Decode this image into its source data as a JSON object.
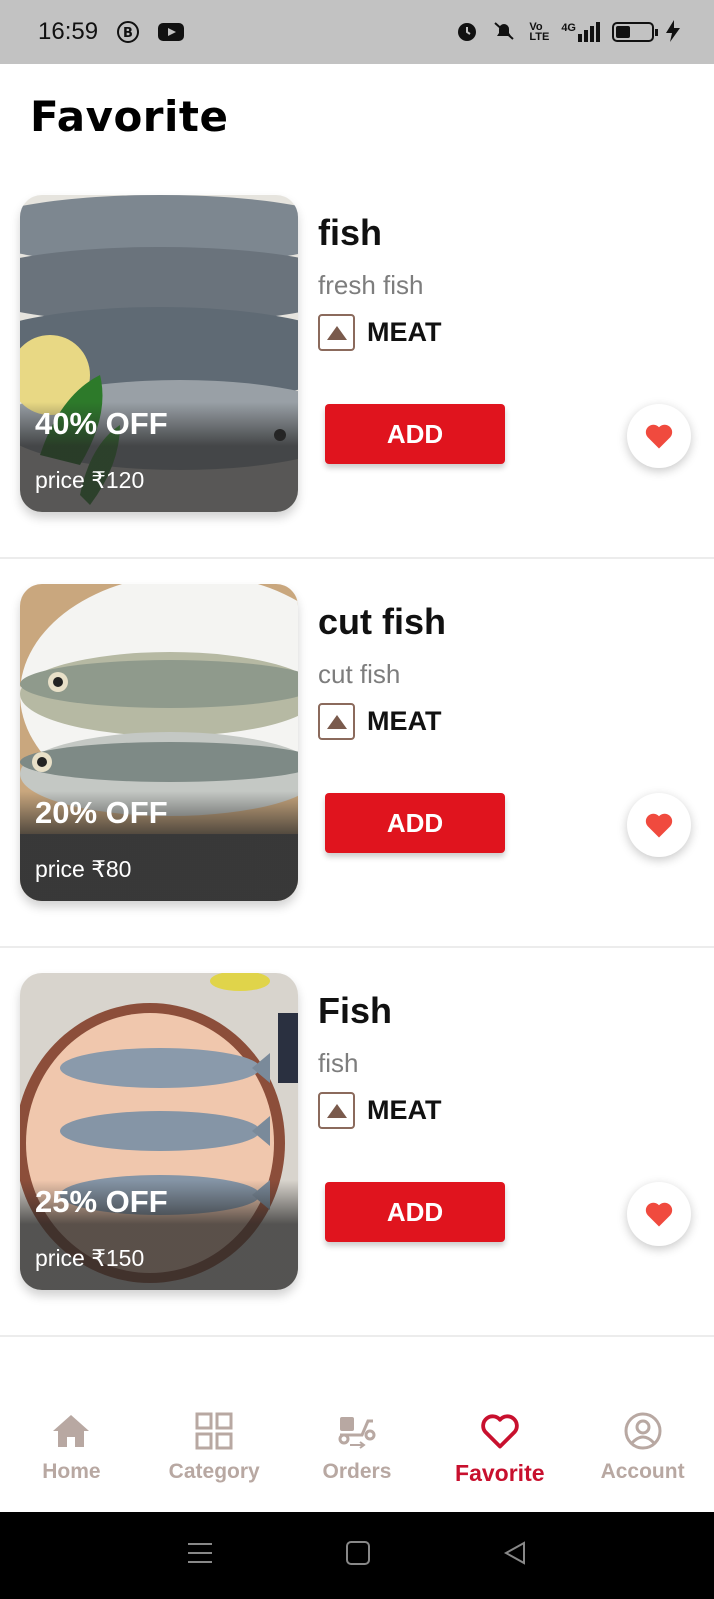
{
  "status_bar": {
    "time": "16:59",
    "network": "4G"
  },
  "page": {
    "title": "Favorite"
  },
  "items": [
    {
      "name": "fish",
      "subtitle": "fresh fish",
      "category": "MEAT",
      "discount": "40% OFF",
      "price": "price ₹120",
      "add_label": "ADD",
      "favorited": true
    },
    {
      "name": "cut fish",
      "subtitle": "cut fish",
      "category": "MEAT",
      "discount": "20% OFF",
      "price": "price ₹80",
      "add_label": "ADD",
      "favorited": true
    },
    {
      "name": "Fish",
      "subtitle": "fish",
      "category": "MEAT",
      "discount": "25% OFF",
      "price": "price ₹150",
      "add_label": "ADD",
      "favorited": true
    }
  ],
  "bottom_nav": [
    {
      "label": "Home",
      "icon": "home-icon",
      "active": false
    },
    {
      "label": "Category",
      "icon": "grid-icon",
      "active": false
    },
    {
      "label": "Orders",
      "icon": "scooter-icon",
      "active": false
    },
    {
      "label": "Favorite",
      "icon": "heart-outline-icon",
      "active": true
    },
    {
      "label": "Account",
      "icon": "user-circle-icon",
      "active": false
    }
  ],
  "colors": {
    "accent": "#e0141e",
    "nav_active": "#c8102e",
    "nav_inactive": "#b8a8a2",
    "heart": "#f04a3e"
  }
}
